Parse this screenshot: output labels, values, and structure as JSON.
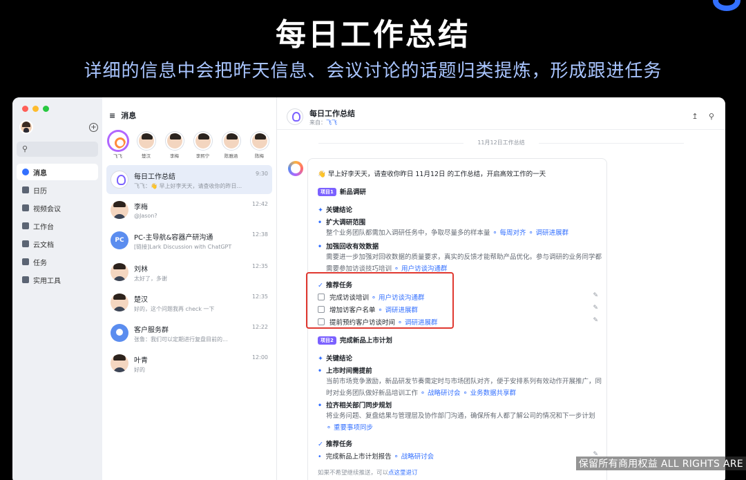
{
  "hero": {
    "title": "每日工作总结",
    "subtitle": "详细的信息中会把昨天信息、会议讨论的话题归类提炼，形成跟进任务"
  },
  "nav": {
    "search_icon": "search-icon",
    "items": [
      {
        "label": "消息",
        "icon": "message-icon",
        "active": true
      },
      {
        "label": "日历",
        "icon": "calendar-icon"
      },
      {
        "label": "视频会议",
        "icon": "video-icon"
      },
      {
        "label": "工作台",
        "icon": "grid-icon"
      },
      {
        "label": "云文档",
        "icon": "doc-icon"
      },
      {
        "label": "任务",
        "icon": "check-icon"
      },
      {
        "label": "实用工具",
        "icon": "tools-icon"
      }
    ]
  },
  "chat_list": {
    "title": "消息",
    "stories": [
      "飞飞",
      "楚汉",
      "李梅",
      "李熙宁",
      "陈雅涵",
      "陈梅"
    ],
    "chats": [
      {
        "name": "每日工作总结",
        "preview": "飞飞：👋 早上好李天天，请查收你的昨日...",
        "time": "9:30"
      },
      {
        "name": "李梅",
        "preview": "@Jason?",
        "time": "12:42"
      },
      {
        "name": "PC-主导航&容器产研沟通",
        "preview": "[链接]Lark Discussion with ChatGPT",
        "time": "12:38",
        "avatar_text": "PC"
      },
      {
        "name": "刘林",
        "preview": "太好了，多谢",
        "time": "12:35"
      },
      {
        "name": "楚汉",
        "preview": "好的，这个问题我再 check 一下",
        "time": "12:35"
      },
      {
        "name": "客户服务群",
        "preview": "张鲁：我们可以定期进行复盘目前的...",
        "time": "12:22"
      },
      {
        "name": "叶青",
        "preview": "好的",
        "time": "12:00"
      }
    ]
  },
  "conversation": {
    "title": "每日工作总结",
    "from_label": "来自：",
    "from_name": "飞飞",
    "date_separator": "11月12日工作总结",
    "greeting": "👋 早上好李天天，请查收你昨日 11月12日 的工作总结，开启高效工作的一天",
    "projects": [
      {
        "tag": "项目1",
        "name": "新品调研",
        "conclusion_title": "关键结论",
        "conclusions": [
          {
            "title": "扩大调研范围",
            "desc": "整个业务团队都需加入调研任务中，争取尽量多的样本量",
            "links": [
              "每周对齐",
              "调研进展群"
            ]
          },
          {
            "title": "加强回收有效数据",
            "desc": "需要进一步加强对回收数据的质量要求，真实的反馈才能帮助产品优化。参与调研的业务同学都需要参加访谈技巧培训",
            "links": [
              "用户访谈沟通群"
            ]
          }
        ],
        "task_title": "推荐任务",
        "tasks": [
          {
            "label": "完成访谈培训",
            "link": "用户访谈沟通群"
          },
          {
            "label": "增加访客户名单",
            "link": "调研进展群"
          },
          {
            "label": "提前预约客户访谈时间",
            "link": "调研进展群"
          }
        ]
      },
      {
        "tag": "项目2",
        "name": "完成新品上市计划",
        "conclusion_title": "关键结论",
        "conclusions": [
          {
            "title": "上市时间需提前",
            "desc": "当前市场竞争激励，新品研发节奏需定时与市场团队对齐，便于安排系列有效动作开展推广，同时对业务团队做好新品培训工作",
            "links": [
              "战略研讨会",
              "业务数据共享群"
            ]
          },
          {
            "title": "拉齐相关部门同步规划",
            "desc": "将业务问题、复盘结果与管理层及协作部门沟通，确保所有人都了解公司的情况和下一步计划",
            "links": [
              "重要事项同步"
            ]
          }
        ],
        "task_title": "推荐任务",
        "tasks": [
          {
            "label": "完成新品上市计划报告",
            "link": "战略研讨会"
          }
        ]
      }
    ],
    "unsubscribe_prefix": "如果不希望继续推送，可以",
    "unsubscribe_link": "点这里退订"
  },
  "watermark": "保留所有商用权益  ALL RIGHTS ARE",
  "colors": {
    "accent": "#3370ff",
    "highlight_border": "#e0372f",
    "tag": "#7b61ff"
  }
}
